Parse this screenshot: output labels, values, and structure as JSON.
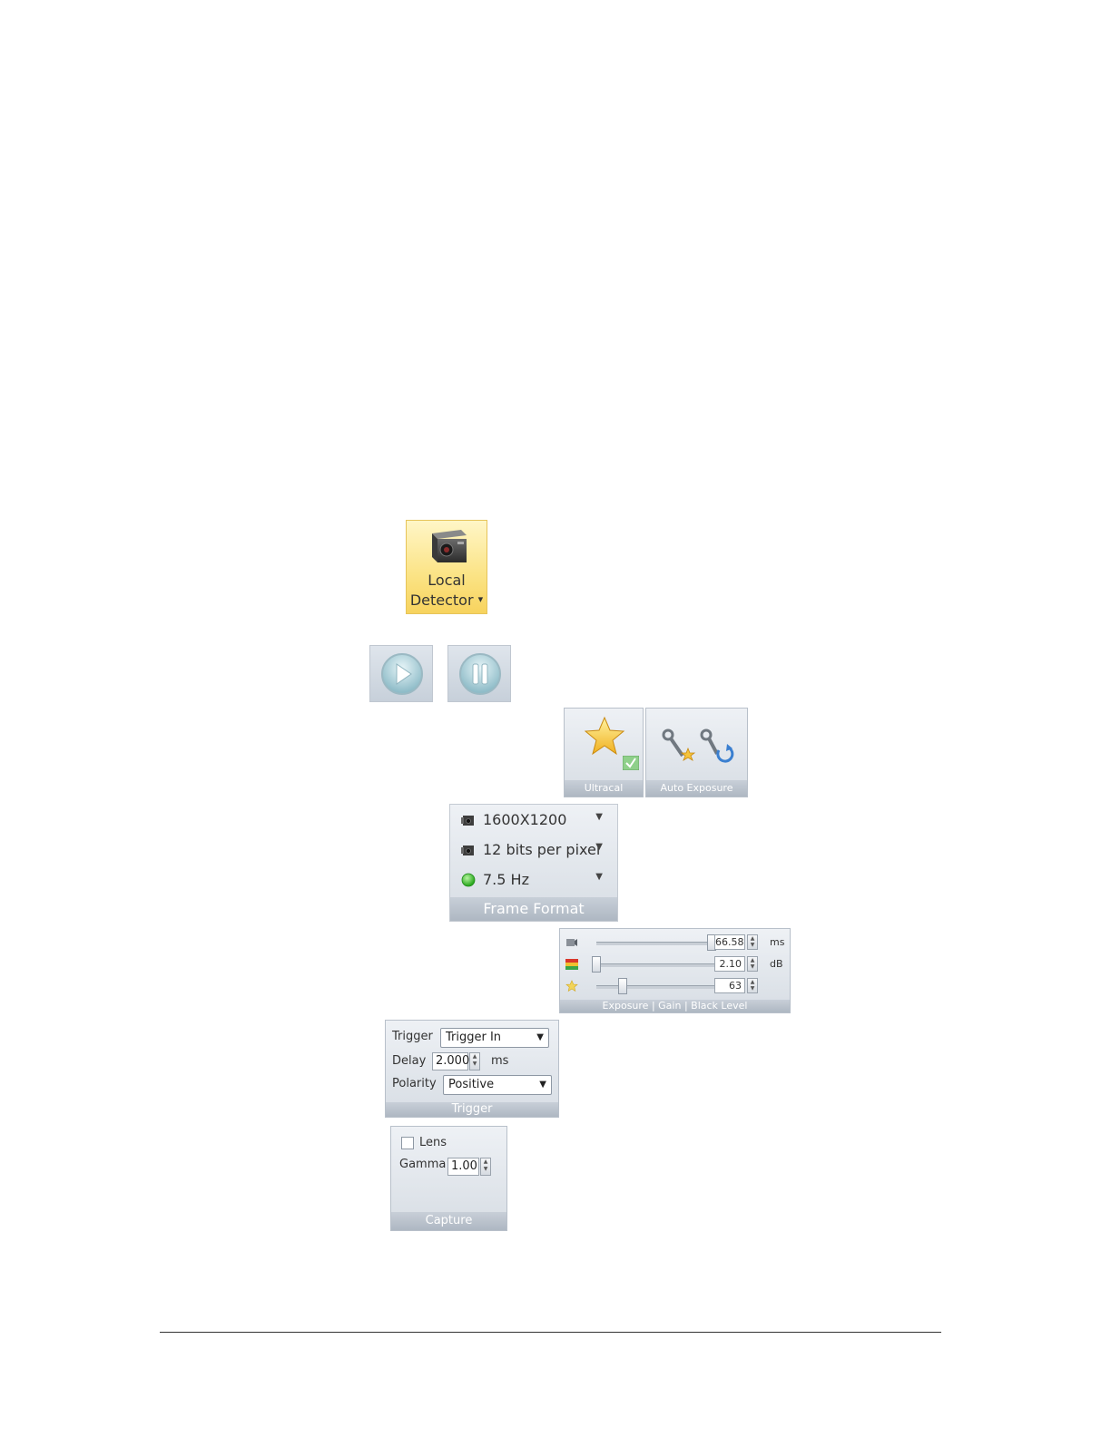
{
  "local_detector": {
    "line1": "Local",
    "line2": "Detector",
    "dropdown_glyph": "▾",
    "icon": "camera-icon"
  },
  "playback": {
    "play_icon": "play-icon",
    "pause_icon": "pause-icon"
  },
  "ultracal": {
    "label": "Ultracal",
    "icons": [
      "star-icon",
      "check-icon"
    ]
  },
  "auto_exposure": {
    "label": "Auto Exposure",
    "icons": [
      "wrench-star-icon",
      "wrench-refresh-icon"
    ]
  },
  "frame_format": {
    "title": "Frame Format",
    "items": [
      {
        "text": "1600X1200",
        "icon": "camera-small-icon"
      },
      {
        "text": "12 bits per pixel",
        "icon": "camera-small-icon"
      },
      {
        "text": "7.5 Hz",
        "icon": "green-dot-icon"
      }
    ],
    "arrow": "▼"
  },
  "exposure_gain_black": {
    "title": "Exposure | Gain | Black Level",
    "rows": [
      {
        "value": "66.58",
        "unit": "ms",
        "level": 0.98,
        "icon": "exposure-icon"
      },
      {
        "value": "2.10",
        "unit": "dB",
        "level": 0.0,
        "icon": "gain-icon"
      },
      {
        "value": "63",
        "unit": "",
        "level": 0.22,
        "icon": "black-level-icon"
      }
    ]
  },
  "trigger": {
    "title": "Trigger",
    "trigger_label": "Trigger",
    "trigger_value": "Trigger In",
    "delay_label": "Delay",
    "delay_value": "2.000",
    "delay_unit": "ms",
    "polarity_label": "Polarity",
    "polarity_value": "Positive",
    "arrow": "▼"
  },
  "capture": {
    "title": "Capture",
    "lens_label": "Lens",
    "gamma_label": "Gamma",
    "gamma_value": "1.00"
  },
  "colors": {
    "ribbon_highlight": "#fbe384",
    "ribbon_bg": "#d7dde4",
    "footer_bg": "#aeb7c2"
  }
}
